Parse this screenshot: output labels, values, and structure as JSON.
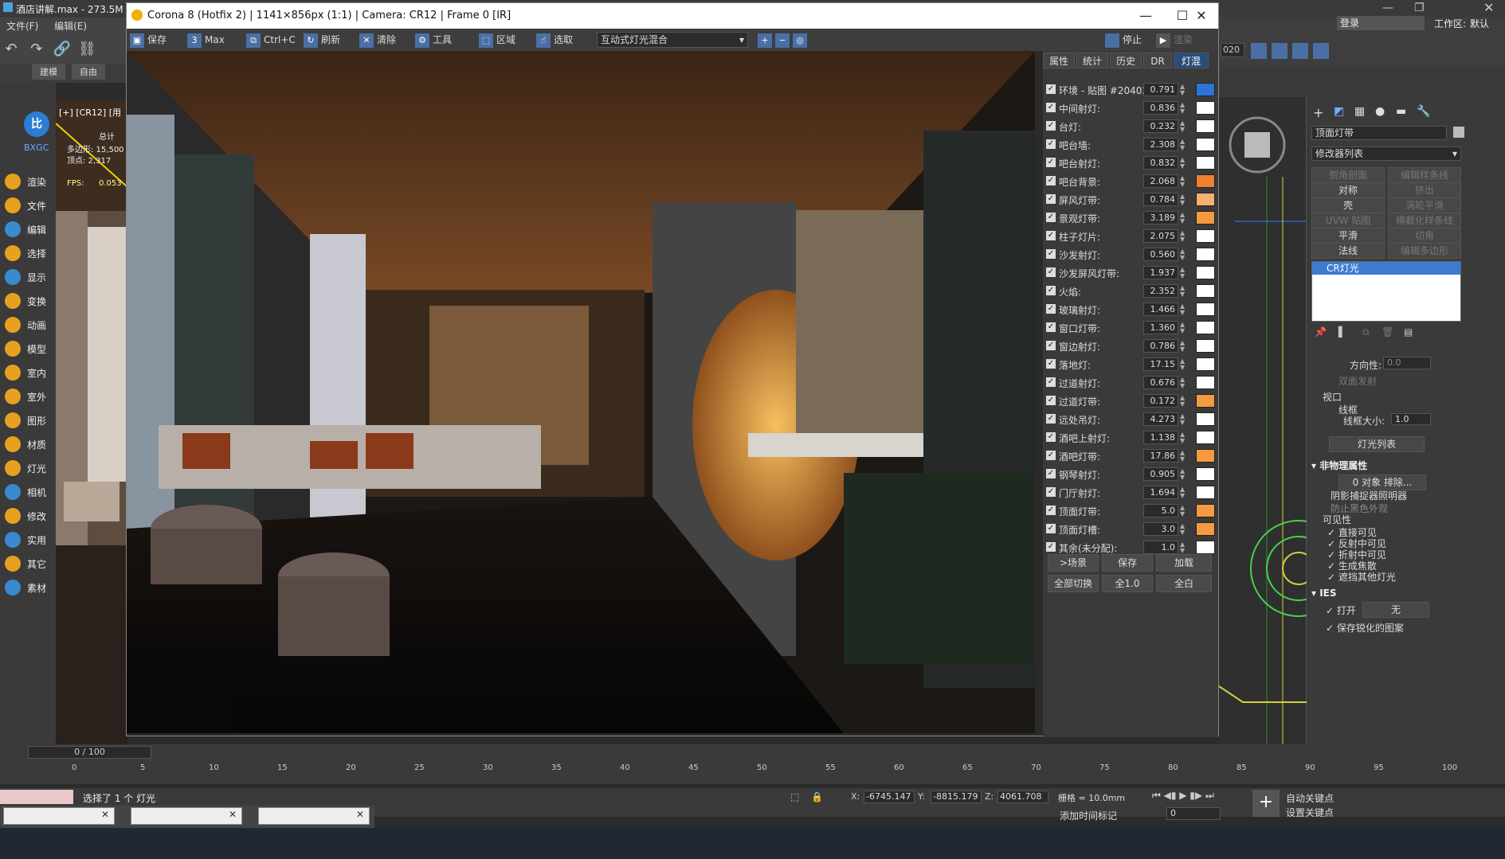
{
  "max": {
    "title": "酒店讲解.max - 273.5M",
    "menu": [
      "文件(F)",
      "编辑(E)"
    ],
    "tabs": [
      "建模",
      "自由"
    ],
    "left_items": [
      "渲染",
      "文件",
      "编辑",
      "选择",
      "显示",
      "变换",
      "动画",
      "模型",
      "室内",
      "室外",
      "图形",
      "材质",
      "灯光",
      "相机",
      "修改",
      "实用",
      "其它",
      "素材"
    ],
    "left_vp": {
      "label": "[+] [CR12] [用",
      "total": "总计",
      "polys": "多边形: 15,500",
      "verts": "顶点: 2,317",
      "fps": "FPS:",
      "fps_val": "0.053"
    },
    "brand": "BXGC",
    "login": "登录",
    "workspace_label": "工作区:",
    "workspace_value": "默认",
    "year_field": "020"
  },
  "corona": {
    "title": "Corona 8 (Hotfix 2) | 1141×856px (1:1) | Camera: CR12 | Frame 0 [IR]",
    "toolbar": {
      "save": "保存",
      "max": "Max",
      "copy": "Ctrl+C",
      "refresh": "刷新",
      "clear": "清除",
      "tools": "工具",
      "region": "区域",
      "select": "选取",
      "lightmix": "互动式灯光混合",
      "stop": "停止",
      "render": "渲染"
    },
    "tabs": [
      "属性",
      "统计",
      "历史",
      "DR",
      "灯混"
    ],
    "lights": [
      {
        "name": "环境 - 贴图 #204021",
        "value": "0.791",
        "color": "#2e73d8"
      },
      {
        "name": "中间射灯:",
        "value": "0.836",
        "color": "#ffffff"
      },
      {
        "name": "台灯:",
        "value": "0.232",
        "color": "#ffffff"
      },
      {
        "name": "吧台墙:",
        "value": "2.308",
        "color": "#ffffff"
      },
      {
        "name": "吧台射灯:",
        "value": "0.832",
        "color": "#ffffff"
      },
      {
        "name": "吧台背景:",
        "value": "2.068",
        "color": "#f08030"
      },
      {
        "name": "屏风灯带:",
        "value": "0.784",
        "color": "#f6b070"
      },
      {
        "name": "景观灯带:",
        "value": "3.189",
        "color": "#f59a40"
      },
      {
        "name": "柱子灯片:",
        "value": "2.075",
        "color": "#ffffff"
      },
      {
        "name": "沙发射灯:",
        "value": "0.560",
        "color": "#ffffff"
      },
      {
        "name": "沙发屏风灯带:",
        "value": "1.937",
        "color": "#ffffff"
      },
      {
        "name": "火焰:",
        "value": "2.352",
        "color": "#ffffff"
      },
      {
        "name": "玻璃射灯:",
        "value": "1.466",
        "color": "#ffffff"
      },
      {
        "name": "窗口灯带:",
        "value": "1.360",
        "color": "#ffffff"
      },
      {
        "name": "窗边射灯:",
        "value": "0.786",
        "color": "#ffffff"
      },
      {
        "name": "落地灯:",
        "value": "17.15",
        "color": "#ffffff"
      },
      {
        "name": "过道射灯:",
        "value": "0.676",
        "color": "#ffffff"
      },
      {
        "name": "过道灯带:",
        "value": "0.172",
        "color": "#f59a40"
      },
      {
        "name": "远处吊灯:",
        "value": "4.273",
        "color": "#ffffff"
      },
      {
        "name": "酒吧上射灯:",
        "value": "1.138",
        "color": "#ffffff"
      },
      {
        "name": "酒吧灯带:",
        "value": "17.86",
        "color": "#f59a40"
      },
      {
        "name": "钢琴射灯:",
        "value": "0.905",
        "color": "#ffffff"
      },
      {
        "name": "门厅射灯:",
        "value": "1.694",
        "color": "#ffffff"
      },
      {
        "name": "顶面灯带:",
        "value": "5.0",
        "color": "#f59a40"
      },
      {
        "name": "顶面灯槽:",
        "value": "3.0",
        "color": "#f59a40"
      },
      {
        "name": "其余(未分配):",
        "value": "1.0",
        "color": "#ffffff"
      }
    ],
    "buttons": {
      "to_scene": ">场景",
      "save": "保存",
      "load": "加载",
      "toggle_all": "全部切换",
      "all_one": "全1.0",
      "all_white": "全白"
    }
  },
  "cmd": {
    "object_name": "顶面灯带",
    "modifier_list": "修改器列表",
    "mod_buttons": [
      [
        "倒角剖面",
        "编辑样条线"
      ],
      [
        "对称",
        "挤出"
      ],
      [
        "壳",
        "涡轮平滑"
      ],
      [
        "UVW 贴图",
        "横截化样条线"
      ],
      [
        "平滑",
        "切角"
      ],
      [
        "法线",
        "编辑多边形"
      ]
    ],
    "stack_item": "CR灯光",
    "directionality": "方向性:",
    "dir_val": "0.0",
    "two_sided": "双面发射",
    "viewport": "视口",
    "wireframe": "线框",
    "wire_size": "线框大小:",
    "wire_val": "1.0",
    "light_list": "灯光列表",
    "nonphys": "非物理属性",
    "exclude": "0 对象 排除...",
    "shadow_catcher": "阴影捕捉器照明器",
    "prevent_black": "防止黑色外观",
    "visibility": "可见性",
    "vis_items": [
      "直接可见",
      "反射中可见",
      "折射中可见",
      "生成焦散",
      "遮挡其他灯光"
    ],
    "ies": "IES",
    "ies_on": "打开",
    "ies_none": "无",
    "ies_keep": "保存锐化的图案"
  },
  "timeline": {
    "frame": "0 / 100",
    "ticks": [
      "0",
      "5",
      "10",
      "15",
      "20",
      "25",
      "30",
      "35",
      "40",
      "45",
      "50",
      "55",
      "60",
      "65",
      "70",
      "75",
      "80",
      "85",
      "90",
      "95",
      "100"
    ]
  },
  "status": {
    "selected": "选择了 1 个 灯光",
    "x_label": "X:",
    "x_val": "-6745.147",
    "y_label": "Y:",
    "y_val": "-8815.179",
    "z_label": "Z:",
    "z_val": "4061.708",
    "grid": "栅格 = 10.0mm",
    "auto_key": "自动关键点",
    "set_key": "设置关键点",
    "add_time_tag": "添加时间标记",
    "frame_field": "0"
  }
}
